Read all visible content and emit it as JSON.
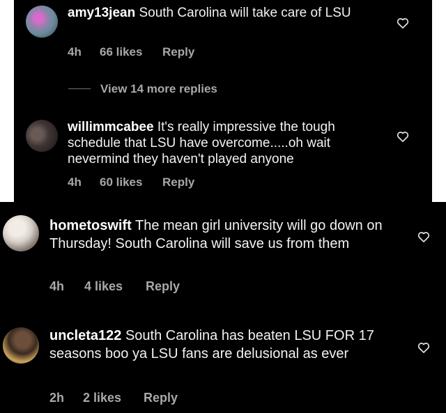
{
  "comments": [
    {
      "username": "amy13jean",
      "text": "South Carolina will take care of LSU",
      "time": "4h",
      "likes": "66 likes",
      "reply": "Reply"
    },
    {
      "username": "willimmcabee",
      "text": "It's really impressive the tough schedule that LSU have overcome.....oh wait nevermind they haven't played anyone",
      "time": "4h",
      "likes": "60 likes",
      "reply": "Reply"
    },
    {
      "username": "hometoswift",
      "text": "The mean girl university will go down on Thursday! South Carolina will save us from them",
      "time": "4h",
      "likes": "4 likes",
      "reply": "Reply"
    },
    {
      "username": "uncleta122",
      "text": "South Carolina has beaten LSU FOR 17 seasons boo ya LSU fans are delusional as ever",
      "time": "2h",
      "likes": "2 likes",
      "reply": "Reply"
    }
  ],
  "view_more_replies": "View 14 more replies",
  "colors": {
    "background": "#000000",
    "text": "#f2f2f2",
    "muted": "#a8a8a8",
    "outer": "#ffffff"
  },
  "icons": {
    "like": "heart-outline-icon"
  }
}
